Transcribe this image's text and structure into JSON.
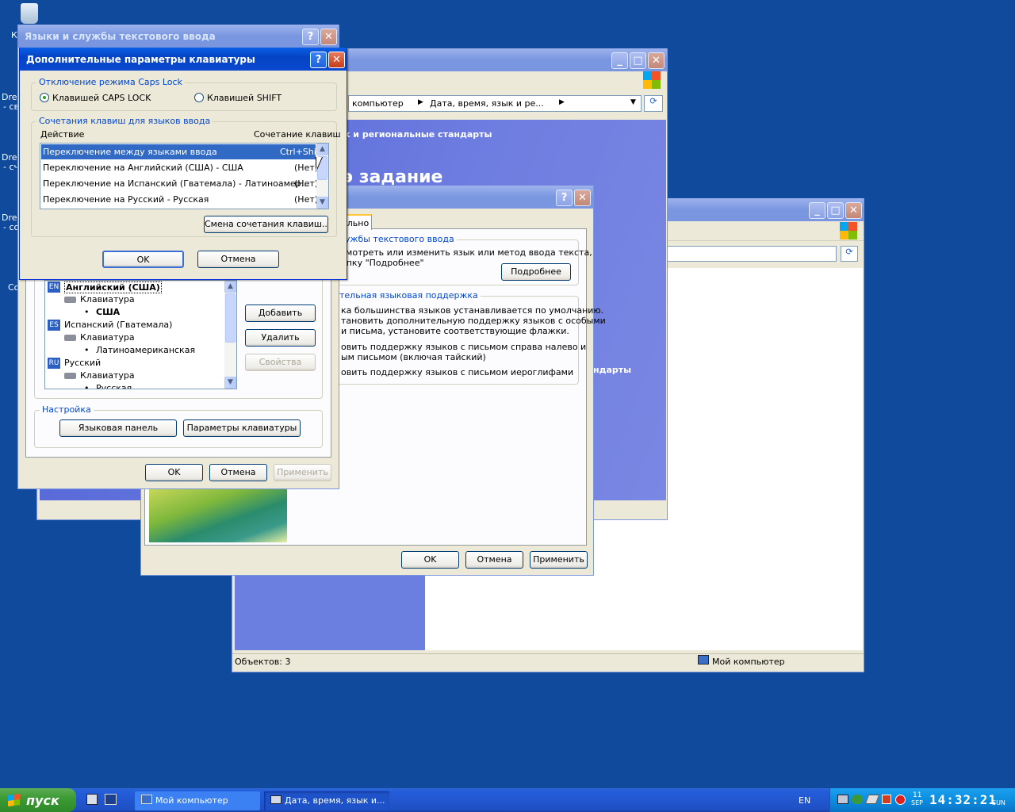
{
  "desktop": {
    "icon_labels": [
      "Drea",
      "- св",
      "Drea",
      "- сч",
      "Drea",
      "- со",
      "Со",
      "К"
    ]
  },
  "back_window": {
    "address_value": "",
    "status_left": "Объектов: 3",
    "status_right": "Мой компьютер"
  },
  "explorer_window": {
    "address_parts": [
      "компьютер",
      "Дата, время, язык и ре..."
    ],
    "banner_title": "к и региональные стандарты",
    "banner_big": "э задание",
    "side_text": "ндарты"
  },
  "regional_dialog": {
    "tab": "ельно",
    "group1": {
      "label": "лужбы текстового ввода",
      "text": "смотреть или изменить язык или метод ввода текста,\nопку \"Подробнее\"",
      "button": "Подробнее"
    },
    "group2": {
      "label": "тельная языковая поддержка",
      "text": "ка большинства языков устанавливается по умолчанию.\nтановить дополнительную поддержку языков с особыми\nи письма, установите соответствующие флажки.",
      "check1": "овить поддержку языков с письмом справа налево и\nым письмом (включая тайский)",
      "check2": "овить поддержку языков с письмом иероглифами"
    },
    "ok": "OK",
    "cancel": "Отмена",
    "apply": "Применить"
  },
  "lang_window": {
    "title": "Языки и службы текстового ввода",
    "tree": [
      {
        "badge": "EN",
        "label": "Английский (США)",
        "kb": "Клавиатура",
        "layout": "США"
      },
      {
        "badge": "ES",
        "label": "Испанский (Гватемала)",
        "kb": "Клавиатура",
        "layout": "Латиноамериканская"
      },
      {
        "badge": "RU",
        "label": "Русский",
        "kb": "Клавиатура",
        "layout": "Русская"
      }
    ],
    "add": "Добавить",
    "remove": "Удалить",
    "props": "Свойства",
    "settings_label": "Настройка",
    "lang_bar": "Языковая панель",
    "kb_params": "Параметры клавиатуры",
    "ok": "OK",
    "cancel": "Отмена",
    "apply": "Применить"
  },
  "kb_dialog": {
    "title": "Дополнительные параметры клавиатуры",
    "caps_group": "Отключение режима Caps Lock",
    "radio_caps": "Клавишей CAPS LOCK",
    "radio_shift": "Клавишей SHIFT",
    "hotkey_group": "Сочетания клавиш для языков ввода",
    "col_action": "Действие",
    "col_keys": "Сочетание клавиш",
    "rows": [
      {
        "action": "Переключение между языками ввода",
        "keys": "Ctrl+Shift"
      },
      {
        "action": "Переключение на Английский (США) - США",
        "keys": "(Нет)"
      },
      {
        "action": "Переключение на Испанский (Гватемала) - Латиноамер...",
        "keys": "(Нет)"
      },
      {
        "action": "Переключение на Русский - Русская",
        "keys": "(Нет)"
      }
    ],
    "change_btn": "Смена сочетания клавиш...",
    "ok": "OK",
    "cancel": "Отмена"
  },
  "taskbar": {
    "start": "пуск",
    "tasks": [
      "Мой компьютер",
      "Дата, время, язык и..."
    ],
    "lang": "EN",
    "clock": "14:32:21",
    "day": "11",
    "month": "SEP",
    "weekday": "SUN"
  },
  "colors": {
    "desktop": "#0f4a9c",
    "title_active": "#0a5fe8",
    "selection": "#316ac5",
    "taskbar": "#245edb",
    "start": "#3c9b34"
  }
}
